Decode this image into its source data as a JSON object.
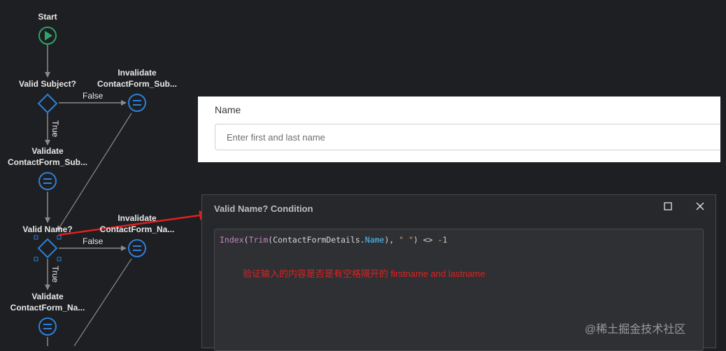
{
  "flow": {
    "start_label": "Start",
    "valid_subject_label": "Valid Subject?",
    "invalidate_subject_label_1": "Invalidate",
    "invalidate_subject_label_2": "ContactForm_Sub...",
    "validate_subject_label_1": "Validate",
    "validate_subject_label_2": "ContactForm_Sub...",
    "valid_name_label": "Valid Name?",
    "invalidate_name_label_1": "Invalidate",
    "invalidate_name_label_2": "ContactForm_Na...",
    "validate_name_label_1": "Validate",
    "validate_name_label_2": "ContactForm_Na...",
    "false_label": "False",
    "true_label": "True",
    "colors": {
      "start": "#2ea36b",
      "assign": "#2f7fd8",
      "decision": "#2f7fd8",
      "connector": "#8a8a8a",
      "arrow": "#e0201e"
    }
  },
  "name_form": {
    "label": "Name",
    "placeholder": "Enter first and last name"
  },
  "dialog": {
    "title": "Valid Name? Condition",
    "maximize_icon": "maximize-icon",
    "close_icon": "close-icon",
    "code": {
      "fn_index": "Index",
      "paren_open": "(",
      "fn_trim": "Trim",
      "paren_open2": "(",
      "obj": "ContactFormDetails.",
      "prop": "Name",
      "after_prop": "), ",
      "str": "\" \"",
      "after_str": ") <> ",
      "num": "-1"
    },
    "annotation": "验证输入的内容是否是有空格隔开的 firstname and lastname"
  },
  "watermark": "@稀土掘金技术社区"
}
